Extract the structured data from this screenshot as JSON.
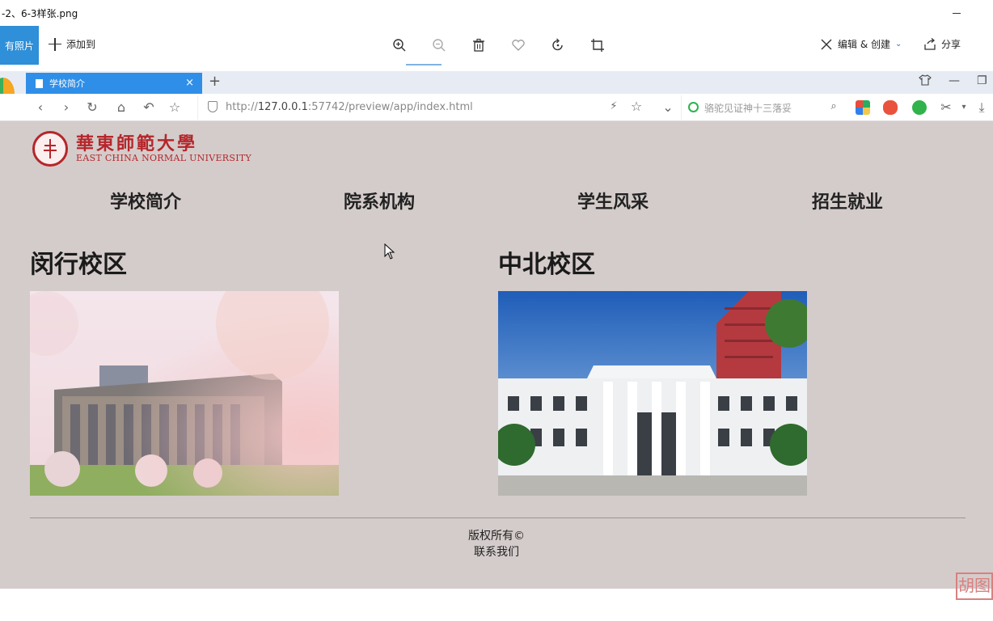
{
  "photos_app": {
    "window_title": "-2、6-3样张.png",
    "all_photos_label": "有照片",
    "add_to_label": "添加到",
    "edit_create_label": "编辑 & 创建",
    "share_label": "分享"
  },
  "browser": {
    "tab_title": "学校简介",
    "tab_close": "×",
    "new_tab": "+",
    "url_prefix": "http://",
    "url_host": "127.0.0.1",
    "url_rest": ":57742/preview/app/index.html",
    "search_placeholder": "骆驼见证神十三落妥"
  },
  "site": {
    "logo_cn": "華東師範大學",
    "logo_en": "EAST CHINA NORMAL UNIVERSITY",
    "nav": [
      "学校简介",
      "院系机构",
      "学生风采",
      "招生就业"
    ],
    "campuses": [
      {
        "title": "闵行校区"
      },
      {
        "title": "中北校区"
      }
    ],
    "footer": {
      "copyright": "版权所有©",
      "contact": "联系我们"
    }
  },
  "watermark": "胡图"
}
